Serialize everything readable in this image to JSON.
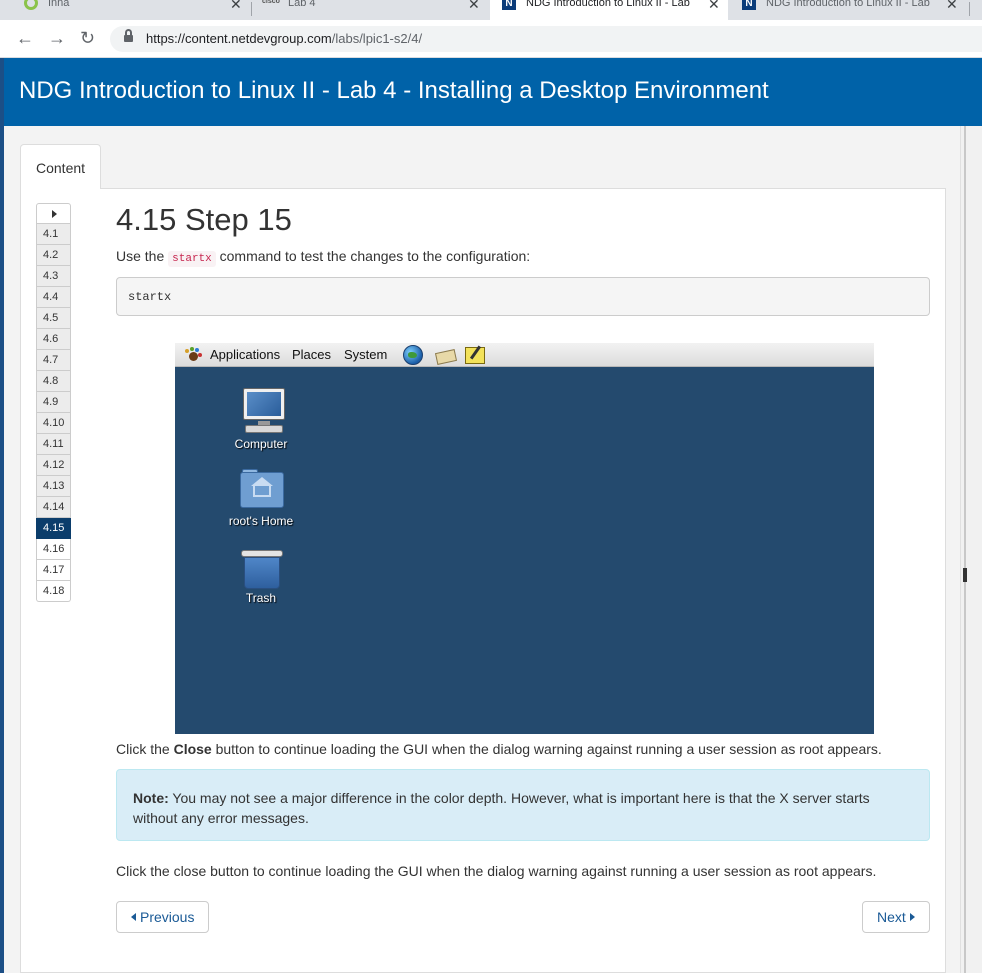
{
  "browser": {
    "tabs": [
      {
        "title": "Inna",
        "icon": "ring-icon"
      },
      {
        "title": "Lab 4",
        "icon": "cisco-icon"
      },
      {
        "title": "NDG Introduction to Linux II - Lab",
        "icon": "ndg-icon",
        "active": true
      },
      {
        "title": "NDG Introduction to Linux II - Lab",
        "icon": "ndg-icon"
      }
    ],
    "close_glyph": "✕",
    "url_host": "https://content.netdevgroup.com",
    "url_path": "/labs/lpic1-s2/4/"
  },
  "header": {
    "title": "NDG Introduction to Linux II - Lab 4 - Installing a Desktop Environment"
  },
  "content_tab": "Content",
  "steps": [
    {
      "label": "4.1",
      "state": "visited"
    },
    {
      "label": "4.2",
      "state": "visited"
    },
    {
      "label": "4.3",
      "state": "visited"
    },
    {
      "label": "4.4",
      "state": "visited"
    },
    {
      "label": "4.5",
      "state": "visited"
    },
    {
      "label": "4.6",
      "state": "visited"
    },
    {
      "label": "4.7",
      "state": "visited"
    },
    {
      "label": "4.8",
      "state": "visited"
    },
    {
      "label": "4.9",
      "state": "visited"
    },
    {
      "label": "4.10",
      "state": "visited"
    },
    {
      "label": "4.11",
      "state": "visited"
    },
    {
      "label": "4.12",
      "state": "visited"
    },
    {
      "label": "4.13",
      "state": "visited"
    },
    {
      "label": "4.14",
      "state": "visited"
    },
    {
      "label": "4.15",
      "state": "active"
    },
    {
      "label": "4.16",
      "state": "unvisited"
    },
    {
      "label": "4.17",
      "state": "unvisited"
    },
    {
      "label": "4.18",
      "state": "unvisited"
    }
  ],
  "main": {
    "title": "4.15 Step 15",
    "intro_before": "Use the ",
    "intro_code": "startx",
    "intro_after": " command to test the changes to the configuration:",
    "code_block": "startx",
    "after_image_before": "Click the ",
    "after_image_bold": "Close",
    "after_image_after": " button to continue loading the GUI when the dialog warning against running a user session as root appears.",
    "note_label": "Note:",
    "note_text": " You may not see a major difference in the color depth. However, what is important here is that the X server starts without any error messages.",
    "closing": "Click the close button to continue loading the GUI when the dialog warning against running a user session as root appears."
  },
  "desktop": {
    "menu": [
      "Applications",
      "Places",
      "System"
    ],
    "icons": [
      {
        "label": "Computer",
        "icon": "computer-icon"
      },
      {
        "label": "root's Home",
        "icon": "home-folder-icon"
      },
      {
        "label": "Trash",
        "icon": "trash-icon"
      }
    ]
  },
  "nav": {
    "previous": "Previous",
    "next": "Next"
  },
  "colors": {
    "header": "#0062a8",
    "active_step": "#0b3d6b",
    "note_bg": "#d9edf7",
    "desktop_bg": "#244a6e"
  }
}
